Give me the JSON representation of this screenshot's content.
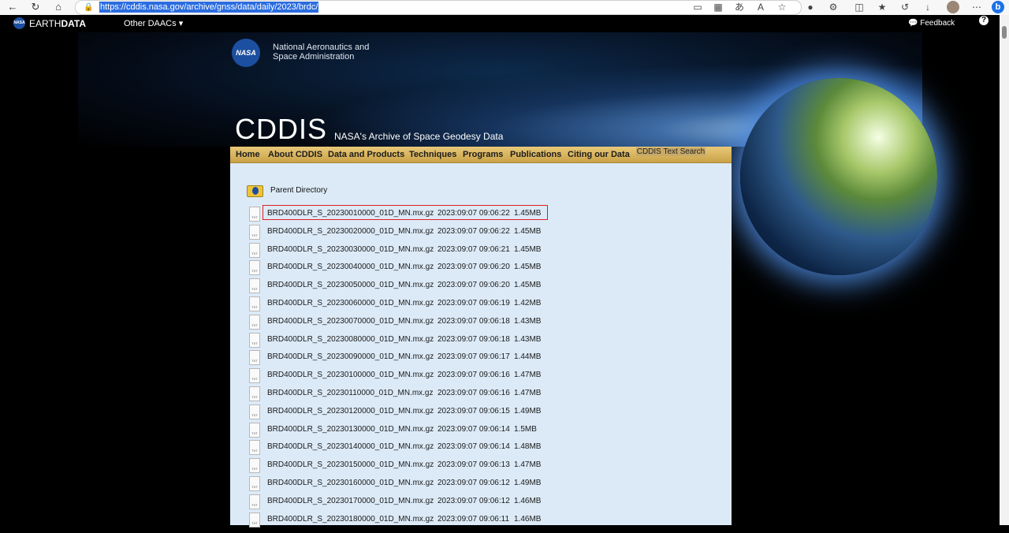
{
  "browser": {
    "url": "https://cddis.nasa.gov/archive/gnss/data/daily/2023/brdc/",
    "icons": [
      "back-icon",
      "refresh-icon",
      "home-icon",
      "lock-icon",
      "read-aloud-icon",
      "apps-icon",
      "translate-icon",
      "read-view-icon",
      "favorite-icon",
      "shield-icon",
      "extensions-icon",
      "split-screen-icon",
      "favorites-icon",
      "history-icon",
      "download-icon",
      "avatar",
      "more-icon",
      "bing-icon"
    ]
  },
  "earthdata": {
    "brand_light": "EARTH",
    "brand_bold": "DATA",
    "other_daacs": "Other DAACs",
    "feedback": "Feedback",
    "help": "?"
  },
  "banner": {
    "agency_line1": "National Aeronautics and",
    "agency_line2": "Space Administration",
    "title": "CDDIS",
    "subtitle": "NASA's Archive of Space Geodesy Data"
  },
  "menu": {
    "items": [
      "Home",
      "About CDDIS",
      "Data and Products",
      "Techniques",
      "Programs",
      "Publications",
      "Citing our Data"
    ],
    "search": "CDDIS Text Search"
  },
  "listing": {
    "parent": "Parent Directory",
    "files": [
      {
        "name": "BRD400DLR_S_20230010000_01D_MN.mx.gz",
        "date": "2023:09:07 09:06:22",
        "size": "1.45MB"
      },
      {
        "name": "BRD400DLR_S_20230020000_01D_MN.mx.gz",
        "date": "2023:09:07 09:06:22",
        "size": "1.45MB"
      },
      {
        "name": "BRD400DLR_S_20230030000_01D_MN.mx.gz",
        "date": "2023:09:07 09:06:21",
        "size": "1.45MB"
      },
      {
        "name": "BRD400DLR_S_20230040000_01D_MN.mx.gz",
        "date": "2023:09:07 09:06:20",
        "size": "1.45MB"
      },
      {
        "name": "BRD400DLR_S_20230050000_01D_MN.mx.gz",
        "date": "2023:09:07 09:06:20",
        "size": "1.45MB"
      },
      {
        "name": "BRD400DLR_S_20230060000_01D_MN.mx.gz",
        "date": "2023:09:07 09:06:19",
        "size": "1.42MB"
      },
      {
        "name": "BRD400DLR_S_20230070000_01D_MN.mx.gz",
        "date": "2023:09:07 09:06:18",
        "size": "1.43MB"
      },
      {
        "name": "BRD400DLR_S_20230080000_01D_MN.mx.gz",
        "date": "2023:09:07 09:06:18",
        "size": "1.43MB"
      },
      {
        "name": "BRD400DLR_S_20230090000_01D_MN.mx.gz",
        "date": "2023:09:07 09:06:17",
        "size": "1.44MB"
      },
      {
        "name": "BRD400DLR_S_20230100000_01D_MN.mx.gz",
        "date": "2023:09:07 09:06:16",
        "size": "1.47MB"
      },
      {
        "name": "BRD400DLR_S_20230110000_01D_MN.mx.gz",
        "date": "2023:09:07 09:06:16",
        "size": "1.47MB"
      },
      {
        "name": "BRD400DLR_S_20230120000_01D_MN.mx.gz",
        "date": "2023:09:07 09:06:15",
        "size": "1.49MB"
      },
      {
        "name": "BRD400DLR_S_20230130000_01D_MN.mx.gz",
        "date": "2023:09:07 09:06:14",
        "size": "1.5MB"
      },
      {
        "name": "BRD400DLR_S_20230140000_01D_MN.mx.gz",
        "date": "2023:09:07 09:06:14",
        "size": "1.48MB"
      },
      {
        "name": "BRD400DLR_S_20230150000_01D_MN.mx.gz",
        "date": "2023:09:07 09:06:13",
        "size": "1.47MB"
      },
      {
        "name": "BRD400DLR_S_20230160000_01D_MN.mx.gz",
        "date": "2023:09:07 09:06:12",
        "size": "1.49MB"
      },
      {
        "name": "BRD400DLR_S_20230170000_01D_MN.mx.gz",
        "date": "2023:09:07 09:06:12",
        "size": "1.46MB"
      },
      {
        "name": "BRD400DLR_S_20230180000_01D_MN.mx.gz",
        "date": "2023:09:07 09:06:11",
        "size": "1.46MB"
      }
    ]
  },
  "colors": {
    "menu_gold": "#d9b865",
    "panel_blue": "#dceaf7",
    "highlight_red": "#e01e1e"
  }
}
